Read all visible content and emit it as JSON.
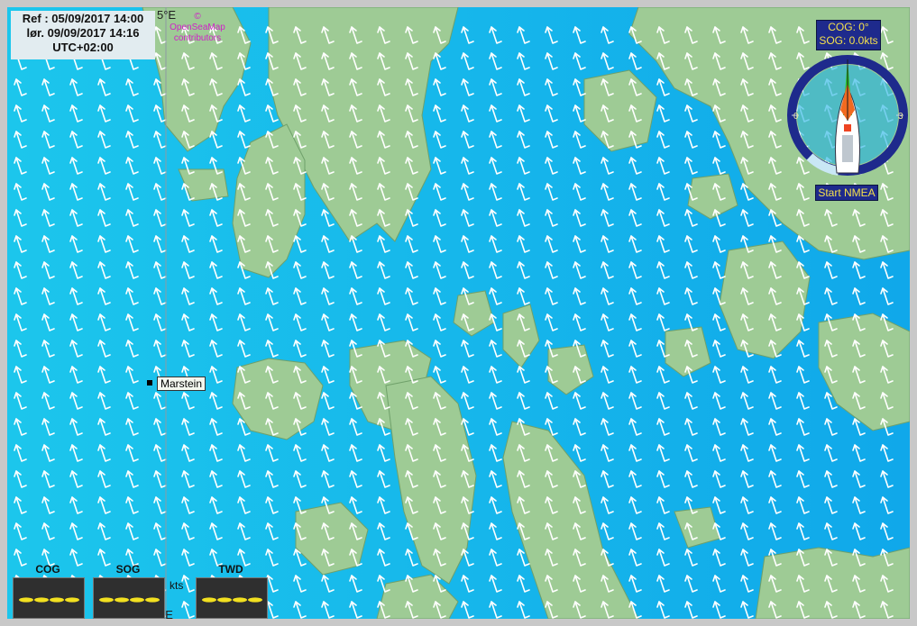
{
  "time": {
    "ref": "Ref : 05/09/2017 14:00",
    "local": "lør. 09/09/2017 14:16",
    "tz": "UTC+02:00"
  },
  "map": {
    "meridian_top": "5°E",
    "meridian_bottom": "°E",
    "attribution": "© OpenSeaMap contributors",
    "place_label": "Marstein",
    "colors": {
      "sea": "#1bb4e6",
      "land": "#9ecb95",
      "arrow": "#ffffff"
    }
  },
  "compass": {
    "cog": "COG: 0°",
    "sog": "SOG: 0.0kts",
    "nmea_button": "Start NMEA",
    "ring_labels": [
      "0",
      "3"
    ]
  },
  "instruments": {
    "cog_label": "COG",
    "sog_label": "SOG",
    "twd_label": "TWD",
    "unit": "kts"
  }
}
